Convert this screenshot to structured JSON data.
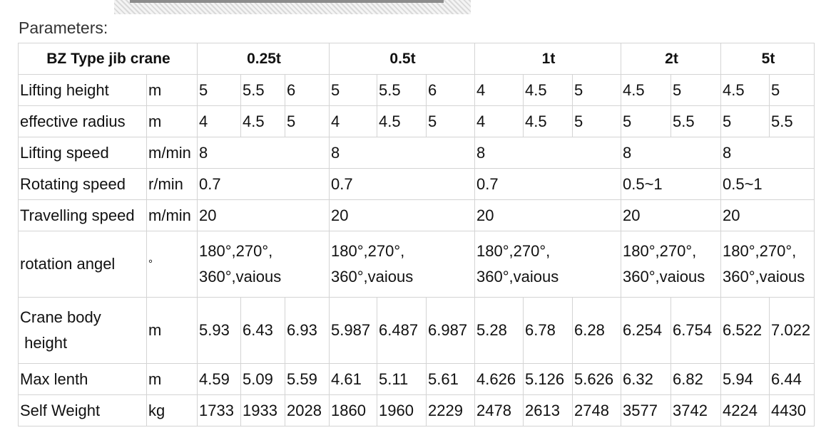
{
  "section_label": "Parameters:",
  "table": {
    "header": [
      "BZ Type jib crane",
      "0.25t",
      "0.5t",
      "1t",
      "2t",
      "5t"
    ],
    "rows": {
      "lifting_height": {
        "label": "Lifting height",
        "unit": "m",
        "cells": [
          "5",
          "5.5",
          "6",
          "5",
          "5.5",
          "6",
          "4",
          "4.5",
          "5",
          "4.5",
          "5",
          "4.5",
          "5"
        ]
      },
      "effective_radius": {
        "label": "effective radius",
        "unit": "m",
        "cells": [
          "4",
          "4.5",
          "5",
          "4",
          "4.5",
          "5",
          "4",
          "4.5",
          "5",
          "5",
          "5.5",
          "5",
          "5.5"
        ]
      },
      "lifting_speed": {
        "label": "Lifting speed",
        "unit": "m/min",
        "cells": [
          "8",
          "8",
          "8",
          "8",
          "8"
        ]
      },
      "rotating_speed": {
        "label": "Rotating speed",
        "unit": "r/min",
        "cells": [
          "0.7",
          "0.7",
          "0.7",
          "0.5~1",
          "0.5~1"
        ]
      },
      "travelling_speed": {
        "label": "Travelling speed",
        "unit": "m/min",
        "cells": [
          "20",
          "20",
          "20",
          "20",
          "20"
        ]
      },
      "rotation_angle": {
        "label": "rotation angel",
        "unit": "°",
        "line1": "180°,270°,",
        "line2": "360°,vaious"
      },
      "crane_body_height": {
        "label_line1": "Crane body",
        "label_line2": " height",
        "unit": "m",
        "cells": [
          "5.93",
          "6.43",
          "6.93",
          "5.987",
          "6.487",
          "6.987",
          "5.28",
          "6.78",
          "6.28",
          "6.254",
          "6.754",
          "6.522",
          "7.022"
        ]
      },
      "max_length": {
        "label": "Max lenth",
        "unit": "m",
        "cells": [
          "4.59",
          "5.09",
          "5.59",
          "4.61",
          "5.11",
          "5.61",
          "4.626",
          "5.126",
          "5.626",
          "6.32",
          "6.82",
          "5.94",
          "6.44"
        ]
      },
      "self_weight": {
        "label": "Self Weight",
        "unit": "kg",
        "cells": [
          "1733",
          "1933",
          "2028",
          "1860",
          "1960",
          "2229",
          "2478",
          "2613",
          "2748",
          "3577",
          "3742",
          "4224",
          "4430"
        ]
      }
    }
  }
}
